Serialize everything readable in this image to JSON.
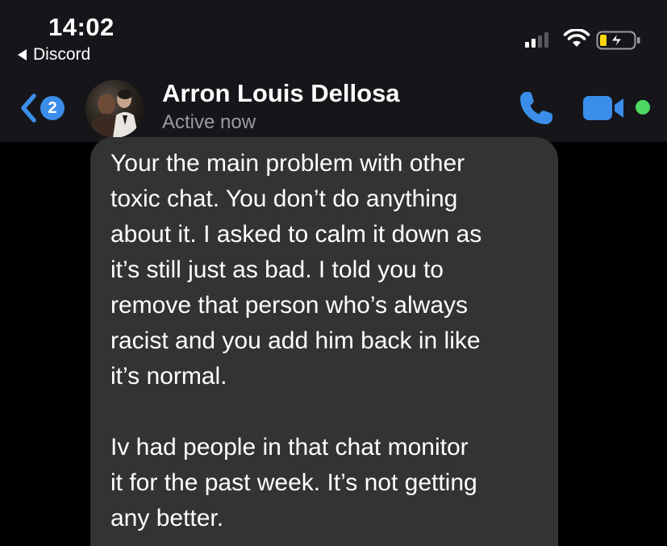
{
  "status_bar": {
    "time": "14:02",
    "back_app_label": "Discord",
    "signal_bars_active": 2,
    "signal_bars_total": 4,
    "battery_level": 0.2,
    "battery_charging": true
  },
  "chat_header": {
    "unread_count": "2",
    "contact_name": "Arron Louis Dellosa",
    "presence_status": "Active now",
    "accent_color": "#3a8ee9",
    "online_color": "#4cd964",
    "icons": [
      "chevron-left-icon",
      "phone-icon",
      "video-camera-icon",
      "online-indicator"
    ]
  },
  "message": {
    "paragraph_1": "Your the main problem with other\ntoxic chat. You don’t do anything\nabout it. I asked to calm it down as\nit’s still just as bad. I told you to\nremove that person who’s always\nracist and you add him back in like\nit’s normal.",
    "paragraph_2": "Iv had people in that chat monitor\nit for the past week. It’s not getting\nany better."
  }
}
